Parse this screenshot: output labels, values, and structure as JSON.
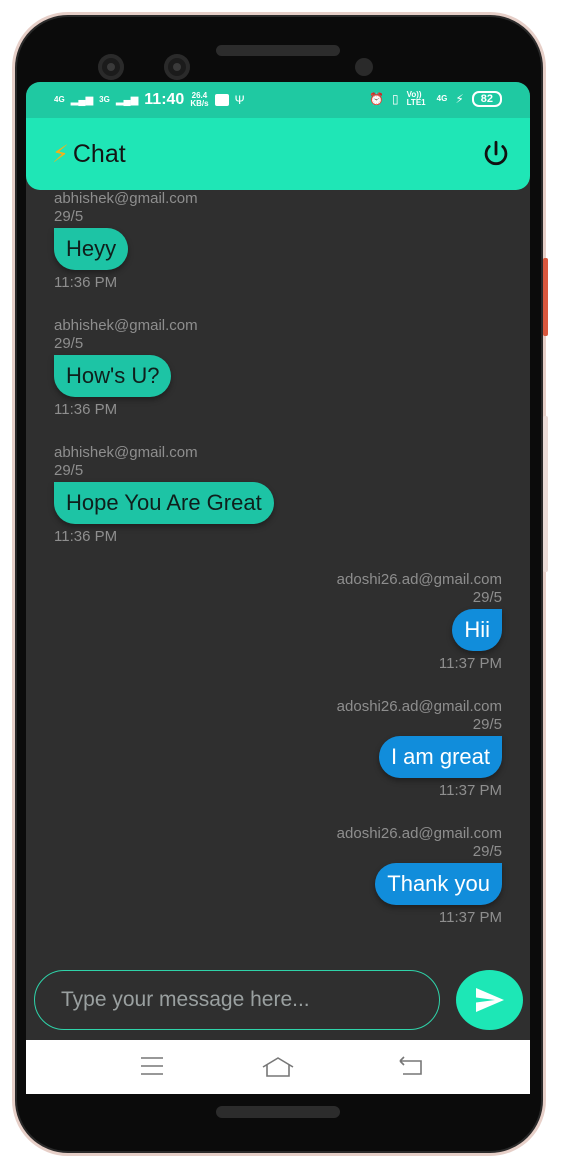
{
  "statusbar": {
    "net1": "4G",
    "net2": "3G",
    "time": "11:40",
    "speed_value": "26.4",
    "speed_unit": "KB/s",
    "volte": "Vo)) LTE1",
    "net3": "4G",
    "battery": "82"
  },
  "header": {
    "icon": "⚡",
    "title": "Chat"
  },
  "messages": [
    {
      "sender": "abhishek@gmail.com",
      "date": "29/5",
      "text": "Heyy",
      "time": "11:36 PM",
      "side": "left"
    },
    {
      "sender": "abhishek@gmail.com",
      "date": "29/5",
      "text": "How's U?",
      "time": "11:36 PM",
      "side": "left"
    },
    {
      "sender": "abhishek@gmail.com",
      "date": "29/5",
      "text": "Hope You Are Great",
      "time": "11:36 PM",
      "side": "left"
    },
    {
      "sender": "adoshi26.ad@gmail.com",
      "date": "29/5",
      "text": "Hii",
      "time": "11:37 PM",
      "side": "right"
    },
    {
      "sender": "adoshi26.ad@gmail.com",
      "date": "29/5",
      "text": "I am great",
      "time": "11:37 PM",
      "side": "right"
    },
    {
      "sender": "adoshi26.ad@gmail.com",
      "date": "29/5",
      "text": "Thank you",
      "time": "11:37 PM",
      "side": "right"
    }
  ],
  "composer": {
    "placeholder": "Type your message here..."
  },
  "icons": {
    "power": "power-icon",
    "send": "send-icon",
    "menu": "menu-icon",
    "home": "home-icon",
    "back": "back-icon"
  },
  "colors": {
    "accent": "#1fe6b6",
    "incoming_bubble": "#1dc4a5",
    "outgoing_bubble": "#118ddb",
    "background": "#2f2f2f"
  }
}
